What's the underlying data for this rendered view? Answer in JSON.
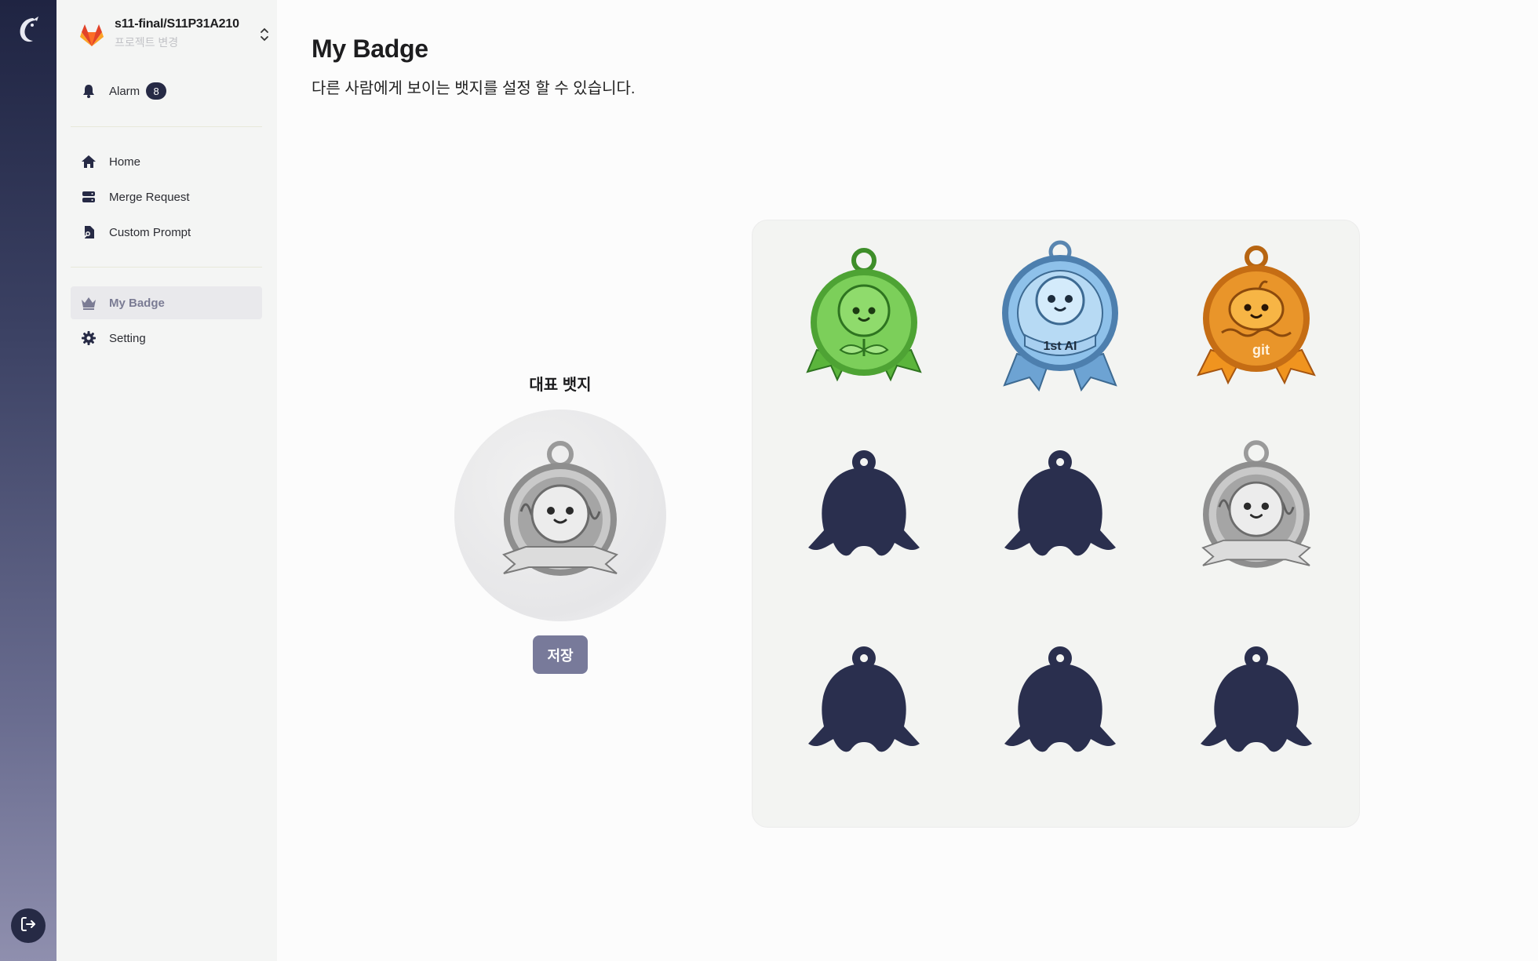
{
  "sidebar": {
    "project": {
      "name": "s11-final/S11P31A210",
      "sub": "프로젝트 변경"
    },
    "alarm": {
      "label": "Alarm",
      "count": "8"
    },
    "nav": {
      "home": "Home",
      "merge_request": "Merge Request",
      "custom_prompt": "Custom Prompt",
      "my_badge": "My Badge",
      "setting": "Setting"
    }
  },
  "page": {
    "title": "My Badge",
    "subtitle": "다른 사람에게 보이는 뱃지를 설정 할 수 있습니다."
  },
  "representative": {
    "label": "대표 뱃지",
    "badge": "silver-medal",
    "save_label": "저장"
  },
  "badges": [
    {
      "name": "green-sprout-medal",
      "locked": false,
      "color": "#6cc24a"
    },
    {
      "name": "blue-1st-ai-medal",
      "locked": false,
      "color": "#7fb4e0",
      "text": "1st AI"
    },
    {
      "name": "orange-git-medal",
      "locked": false,
      "color": "#e98a1f",
      "text": "git"
    },
    {
      "name": "locked-badge",
      "locked": true
    },
    {
      "name": "locked-badge",
      "locked": true
    },
    {
      "name": "silver-medal",
      "locked": false,
      "color": "#b4b4b4"
    },
    {
      "name": "locked-badge",
      "locked": true
    },
    {
      "name": "locked-badge",
      "locked": true
    },
    {
      "name": "locked-badge",
      "locked": true
    }
  ],
  "colors": {
    "rail_top": "#1f2442",
    "locked": "#2a2f4e",
    "accent": "#787a9a"
  },
  "icons": [
    "logo-icon",
    "logout-icon",
    "gitlab-fox-icon",
    "chevron-updown-icon",
    "bell-icon",
    "home-icon",
    "server-icon",
    "custom-prompt-icon",
    "crown-icon",
    "gear-icon"
  ]
}
